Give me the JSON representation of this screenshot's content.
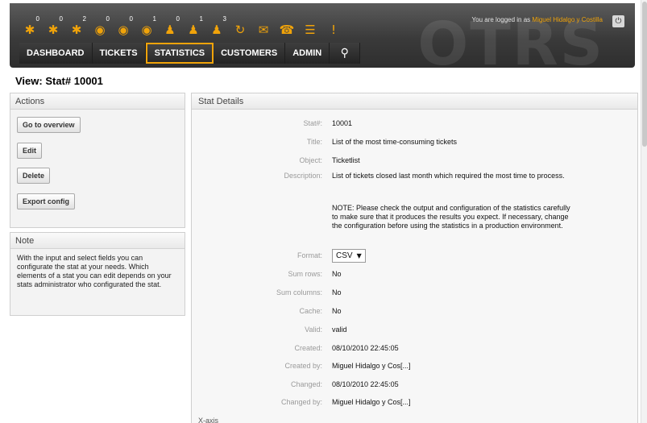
{
  "header": {
    "watermark": "OTRS",
    "login_prefix": "You are logged in as",
    "login_user": "Miguel Hidalgo y Costilla",
    "logout_glyph": "⏻",
    "toolbar": [
      {
        "icon": "locked-tickets-icon",
        "glyph": "✱",
        "count": "0"
      },
      {
        "icon": "locked-new-icon",
        "glyph": "✱",
        "count": "0"
      },
      {
        "icon": "locked-reminder-icon",
        "glyph": "✱",
        "count": "2"
      },
      {
        "icon": "watched-tickets-icon",
        "glyph": "◉",
        "count": "0"
      },
      {
        "icon": "watched-new-icon",
        "glyph": "◉",
        "count": "0"
      },
      {
        "icon": "watched-reminder-icon",
        "glyph": "◉",
        "count": "1"
      },
      {
        "icon": "responsible-tickets-icon",
        "glyph": "♟",
        "count": "0"
      },
      {
        "icon": "responsible-new-icon",
        "glyph": "♟",
        "count": "1"
      },
      {
        "icon": "responsible-reminder-icon",
        "glyph": "♟",
        "count": "3"
      },
      {
        "icon": "reload-icon",
        "glyph": "↻",
        "count": ""
      },
      {
        "icon": "email-ticket-icon",
        "glyph": "✉",
        "count": ""
      },
      {
        "icon": "phone-ticket-icon",
        "glyph": "☎",
        "count": ""
      },
      {
        "icon": "list-icon",
        "glyph": "☰",
        "count": ""
      },
      {
        "icon": "alert-icon",
        "glyph": "!",
        "count": ""
      }
    ],
    "nav": [
      {
        "name": "nav-dashboard",
        "label": "DASHBOARD"
      },
      {
        "name": "nav-tickets",
        "label": "TICKETS"
      },
      {
        "name": "nav-statistics",
        "label": "STATISTICS"
      },
      {
        "name": "nav-customers",
        "label": "CUSTOMERS"
      },
      {
        "name": "nav-admin",
        "label": "ADMIN"
      }
    ],
    "search_glyph": "⚲"
  },
  "page_title": "View: Stat# 10001",
  "actions": {
    "title": "Actions",
    "buttons": [
      "Go to overview",
      "Edit",
      "Delete",
      "Export config"
    ]
  },
  "note": {
    "title": "Note",
    "text": "With the input and select fields you can configurate the stat at your needs. Which elements of a stat you can edit depends on your stats administrator who configurated the stat."
  },
  "details": {
    "title": "Stat Details",
    "stat_number_label": "Stat#:",
    "stat_number": "10001",
    "title_label": "Title:",
    "title_value": "List of the most time-consuming tickets",
    "object_label": "Object:",
    "object_value": "Ticketlist",
    "description_label": "Description:",
    "description_value": "List of tickets closed last month which required the most time to process.",
    "description_note": "NOTE: Please check the output and configuration of the statistics carefully to make sure that it produces the results you expect. If necessary, change the configuration before using the statistics in a production environment.",
    "format_label": "Format:",
    "format_value": "CSV",
    "sum_rows_label": "Sum rows:",
    "sum_rows_value": "No",
    "sum_columns_label": "Sum columns:",
    "sum_columns_value": "No",
    "cache_label": "Cache:",
    "cache_value": "No",
    "valid_label": "Valid:",
    "valid_value": "valid",
    "created_label": "Created:",
    "created_value": "08/10/2010 22:45:05",
    "created_by_label": "Created by:",
    "created_by_value": "Miguel Hidalgo y Cos[...]",
    "changed_label": "Changed:",
    "changed_value": "08/10/2010 22:45:05",
    "changed_by_label": "Changed by:",
    "changed_by_value": "Miguel Hidalgo y Cos[...]",
    "x_axis_label": "X-axis"
  },
  "colors": {
    "accent": "#f0a30a",
    "header_dark": "#3a3a3a"
  }
}
